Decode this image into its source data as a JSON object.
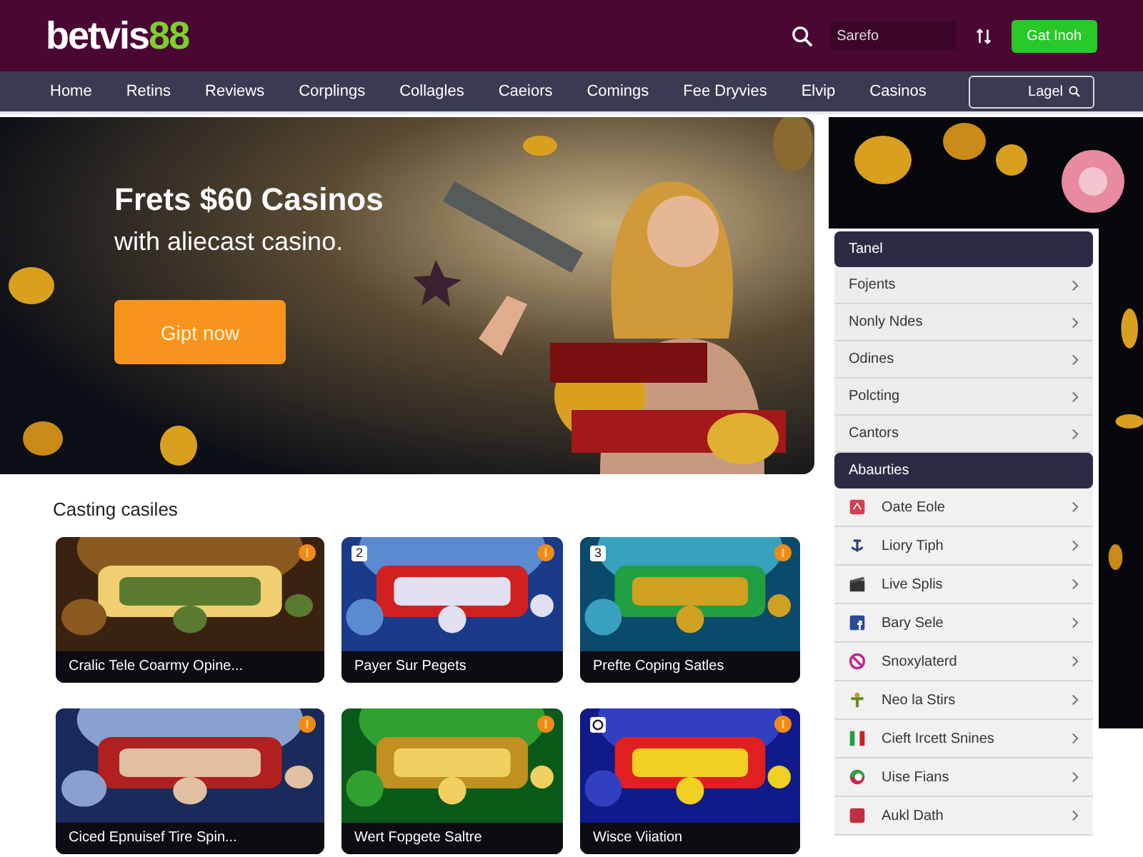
{
  "header": {
    "logo": {
      "text": "betvis",
      "accent": "88"
    },
    "search": {
      "placeholder": "Sarefo"
    },
    "button": "Gat Inoh"
  },
  "nav": {
    "items": [
      "Home",
      "Retins",
      "Reviews",
      "Corplings",
      "Collagles",
      "Caeiors",
      "Comings",
      "Fee Dryvies",
      "Elvip",
      "Casinos"
    ],
    "login": "Lagel"
  },
  "hero": {
    "title": "Frets $60 Casinos",
    "subtitle": "with aliecast casino.",
    "button": "Gipt now"
  },
  "games": {
    "title": "Casting casiles",
    "cards": [
      {
        "caption": "Cralic Tele Coarmy Opine..."
      },
      {
        "caption": "Payer Sur Pegets",
        "tag": {
          "kind": "number",
          "text": "2"
        }
      },
      {
        "caption": "Prefte Coping Satles",
        "tag": {
          "kind": "number",
          "text": "3"
        }
      },
      {
        "caption": "Ciced Epnuisef Tire Spin..."
      },
      {
        "caption": "Wert Fopgete Saltre"
      },
      {
        "caption": "Wisce Viiation",
        "tag": {
          "kind": "icon"
        }
      }
    ]
  },
  "sidebar": {
    "sections": [
      {
        "title": "Tanel",
        "items": [
          {
            "label": "Fojents"
          },
          {
            "label": "Nonly Ndes"
          },
          {
            "label": "Odines"
          },
          {
            "label": "Polcting"
          },
          {
            "label": "Cantors"
          }
        ]
      },
      {
        "title": "Abaurties",
        "items": [
          {
            "label": "Oate Eole"
          },
          {
            "label": "Liory Tiph"
          },
          {
            "label": "Live Splis"
          },
          {
            "label": "Bary Sele"
          },
          {
            "label": "Snoxylaterd"
          },
          {
            "label": "Neo la Stirs"
          },
          {
            "label": "Cieft Ircett Snines"
          },
          {
            "label": "Uise Fians"
          },
          {
            "label": "Aukl Dath"
          }
        ]
      }
    ]
  }
}
